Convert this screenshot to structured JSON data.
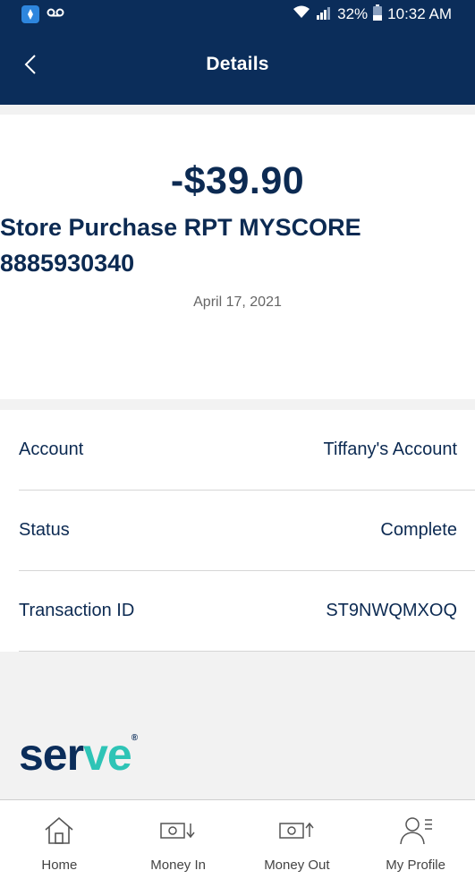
{
  "status_bar": {
    "battery": "32%",
    "time": "10:32 AM"
  },
  "header": {
    "title": "Details",
    "back_icon": "chevron-left-icon"
  },
  "transaction": {
    "amount": "-$39.90",
    "merchant": "Store Purchase RPT MYSCORE 8885930340",
    "date": "April 17, 2021"
  },
  "details": [
    {
      "label": "Account",
      "value": "Tiffany's Account"
    },
    {
      "label": "Status",
      "value": "Complete"
    },
    {
      "label": "Transaction ID",
      "value": "ST9NWQMXOQ"
    }
  ],
  "brand": {
    "logo_text_a": "ser",
    "logo_text_b": "ve",
    "registered": "®",
    "accent": "#2ec4b6",
    "primary": "#0b2d5a"
  },
  "bottom_nav": [
    {
      "label": "Home",
      "icon": "home-icon"
    },
    {
      "label": "Money In",
      "icon": "money-in-icon"
    },
    {
      "label": "Money Out",
      "icon": "money-out-icon"
    },
    {
      "label": "My Profile",
      "icon": "profile-icon"
    }
  ]
}
